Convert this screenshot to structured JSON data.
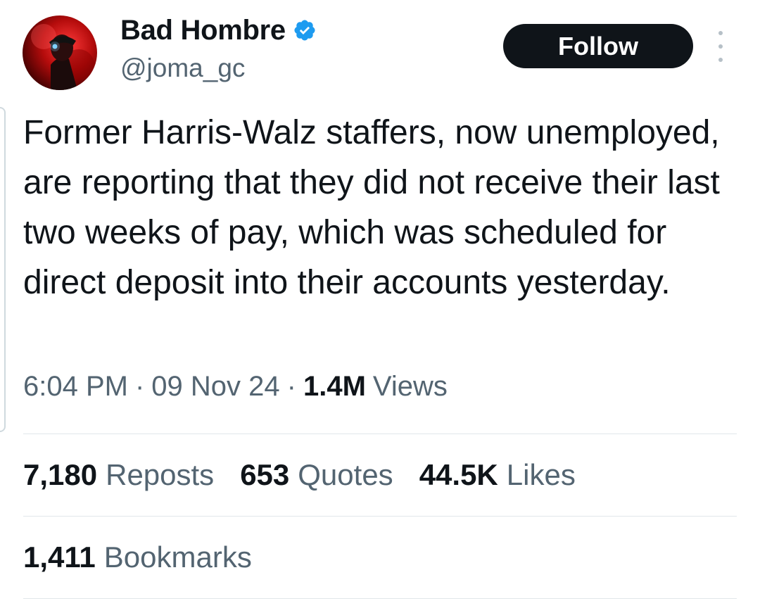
{
  "author": {
    "display_name": "Bad Hombre",
    "handle": "@joma_gc",
    "verified": true
  },
  "actions": {
    "follow_label": "Follow"
  },
  "tweet": {
    "text": "Former Harris-Walz staffers, now unemployed, are reporting that they did not receive their last two weeks of pay, which was scheduled for direct deposit into their accounts yesterday.",
    "time": "6:04 PM",
    "date": "09 Nov 24",
    "separator": "·",
    "views_count": "1.4M",
    "views_label": "Views"
  },
  "stats": {
    "reposts_count": "7,180",
    "reposts_label": "Reposts",
    "quotes_count": "653",
    "quotes_label": "Quotes",
    "likes_count": "44.5K",
    "likes_label": "Likes",
    "bookmarks_count": "1,411",
    "bookmarks_label": "Bookmarks"
  },
  "colors": {
    "text_primary": "#0f1419",
    "text_secondary": "#536471",
    "follow_button_bg": "#0f1419",
    "verified_badge": "#1d9bf0",
    "divider": "#e1e6ea"
  },
  "icons": {
    "verified": "verified-badge-icon",
    "more": "more-vertical-icon"
  }
}
